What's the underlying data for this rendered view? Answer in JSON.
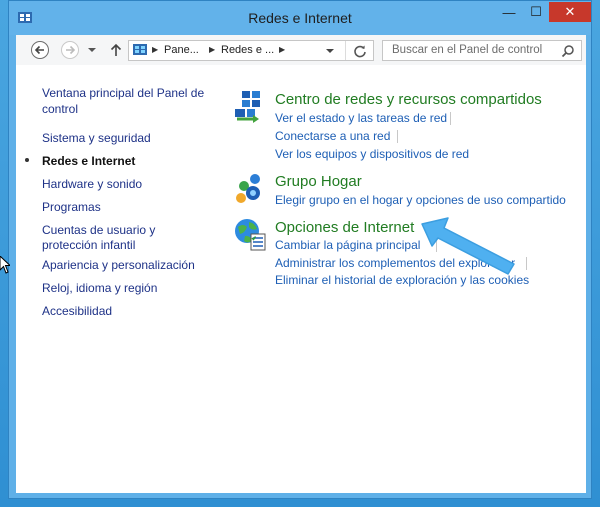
{
  "window": {
    "title": "Redes e Internet",
    "close_label": "✕",
    "max_label": "☐",
    "min_label": "—"
  },
  "address": {
    "crumb_1": "Pane...",
    "crumb_2": "Redes e ..."
  },
  "search": {
    "placeholder": "Buscar en el Panel de control"
  },
  "sidebar": {
    "items": [
      {
        "label": "Ventana principal del Panel de"
      },
      {
        "label": "control"
      },
      {
        "label": "Sistema y seguridad"
      },
      {
        "label": "Redes e Internet"
      },
      {
        "label": "Hardware y sonido"
      },
      {
        "label": "Programas"
      },
      {
        "label": "Cuentas de usuario y"
      },
      {
        "label": "protección infantil"
      },
      {
        "label": "Apariencia y personalización"
      },
      {
        "label": "Reloj, idioma y región"
      },
      {
        "label": "Accesibilidad"
      }
    ]
  },
  "categories": [
    {
      "title": "Centro de redes y recursos compartidos",
      "icon": "network-center-icon",
      "links": [
        "Ver el estado y las tareas de red",
        "Conectarse a una red",
        "Ver los equipos y dispositivos de red"
      ]
    },
    {
      "title": "Grupo Hogar",
      "icon": "homegroup-icon",
      "links": [
        "Elegir grupo en el hogar y opciones de uso compartido"
      ]
    },
    {
      "title": "Opciones de Internet",
      "icon": "internet-options-icon",
      "links": [
        "Cambiar la página principal",
        "Administrar los complementos del explorador",
        "Eliminar el historial de exploración y las cookies"
      ]
    }
  ],
  "colors": {
    "titlebar": "#62b2ea",
    "close_button": "#c7382b",
    "category_title": "#217c22",
    "link": "#1e5fb5",
    "annotation_arrow": "#52b2f0"
  }
}
